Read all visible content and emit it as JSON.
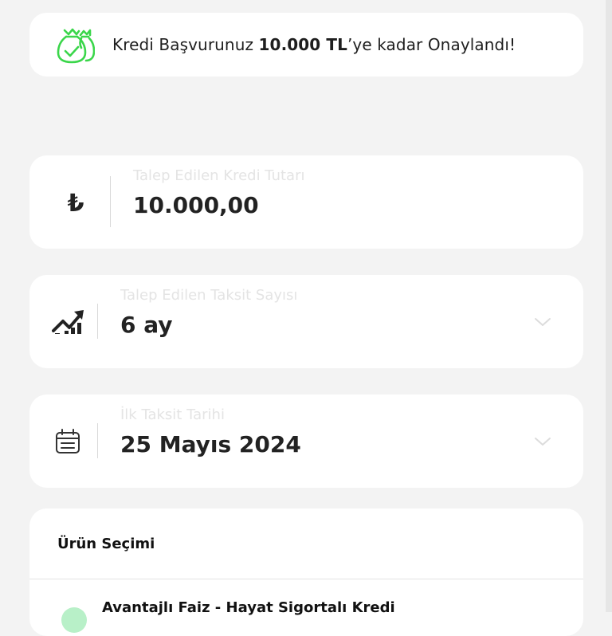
{
  "banner": {
    "text_before": "Kredi Başvurunuz ",
    "amount": "10.000 TL",
    "text_after": "’ye kadar Onaylandı!",
    "icon": "money-bag-check-icon",
    "accent_color": "#3ad64a"
  },
  "amount_field": {
    "icon": "turkish-lira-icon",
    "icon_glyph": "₺",
    "label": "Talep Edilen Kredi Tutarı",
    "value": "10.000,00"
  },
  "installment_field": {
    "icon": "growth-chart-icon",
    "label": "Talep Edilen Taksit Sayısı",
    "value": "6 ay"
  },
  "date_field": {
    "icon": "calendar-icon",
    "label": "İlk Taksit Tarihi",
    "value": "25 Mayıs 2024"
  },
  "product_section": {
    "title": "Ürün Seçimi",
    "option_label": "Avantajlı Faiz - Hayat Sigortalı Kredi"
  }
}
